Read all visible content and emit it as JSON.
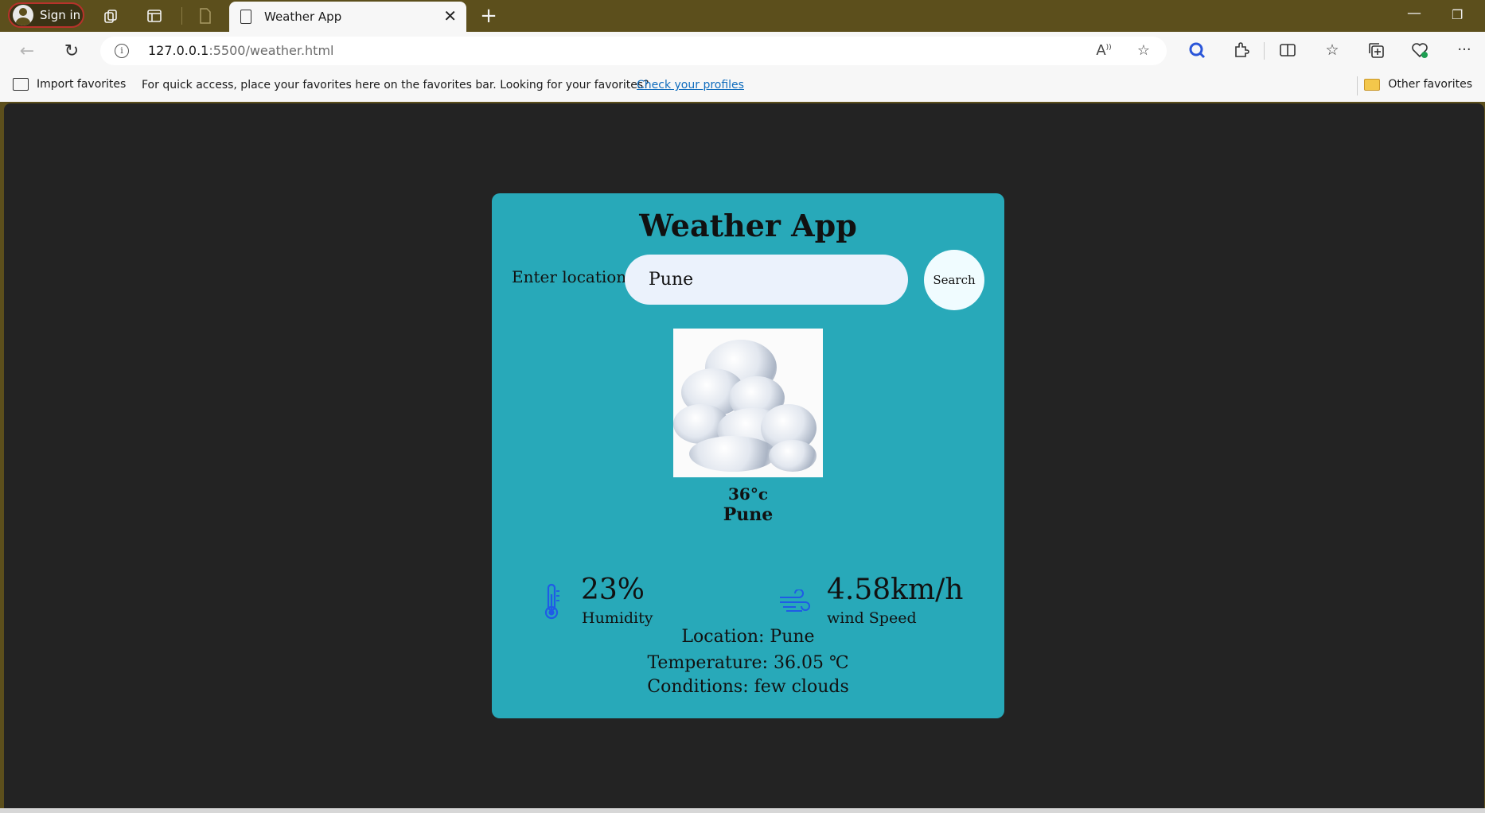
{
  "browser": {
    "signin_label": "Sign in",
    "tab_title": "Weather App",
    "url_host": "127.0.0.1",
    "url_rest": ":5500/weather.html",
    "favorites_bar": {
      "import_label": "Import favorites",
      "message": "For quick access, place your favorites here on the favorites bar. Looking for your favorites?",
      "link_label": "Check your profiles",
      "other_label": "Other favorites"
    }
  },
  "app": {
    "title": "Weather App",
    "search": {
      "label": "Enter location:",
      "value": "Pune",
      "button_label": "Search"
    },
    "current": {
      "temperature": "36°c",
      "city": "Pune",
      "image": "few-clouds"
    },
    "humidity": {
      "value": "23%",
      "label": "Humidity",
      "icon": "thermometer-icon"
    },
    "wind": {
      "value": "4.58km/h",
      "label": "wind Speed",
      "icon": "wind-icon"
    },
    "details": {
      "location": "Location: Pune",
      "temperature": "Temperature: 36.05 ℃",
      "conditions": "Conditions: few clouds"
    }
  },
  "colors": {
    "card_bg": "#28a9b9",
    "page_bg": "#232323",
    "titlebar_bg": "#5c4f1c",
    "icon_blue": "#1f5be6"
  }
}
